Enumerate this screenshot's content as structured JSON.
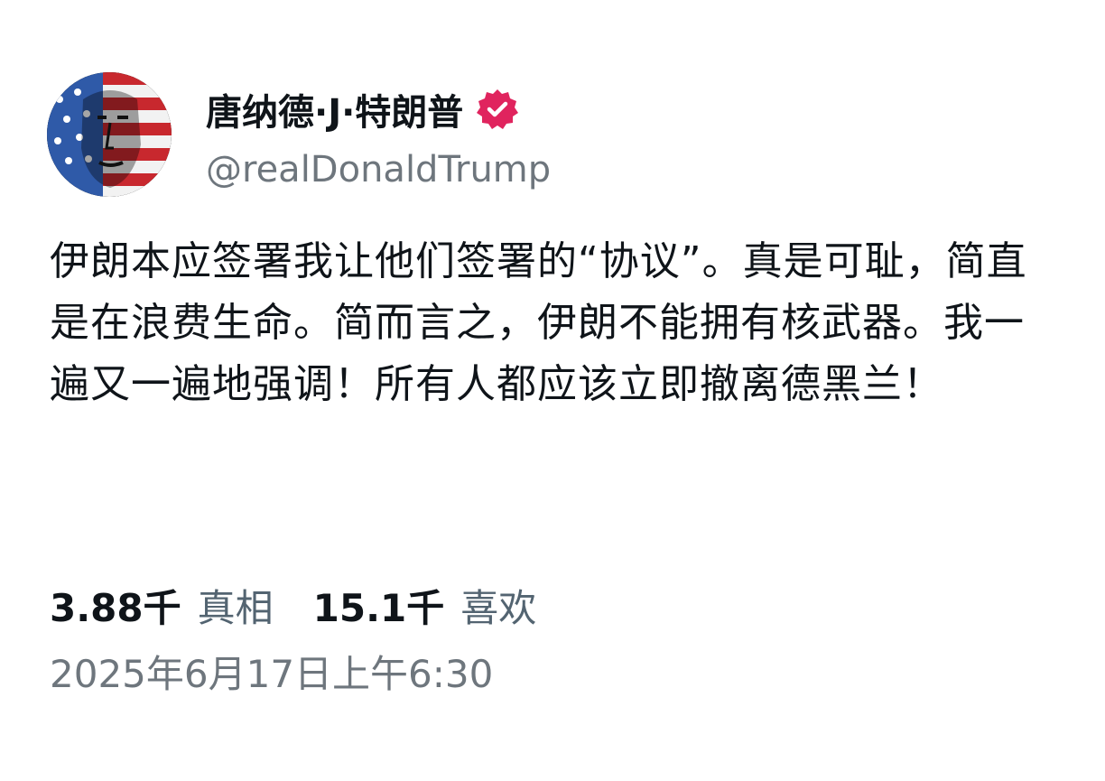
{
  "post": {
    "author": {
      "display_name": "唐纳德·J·特朗普",
      "handle": "@realDonaldTrump",
      "verified_color": "#e0245e",
      "avatar_icon": "flag-portrait-avatar"
    },
    "text": "伊朗本应签署我让他们签署的“协议”。真是可耻，简直是在浪费生命。简而言之，伊朗不能拥有核武器。我一遍又一遍地强调！所有人都应该立即撤离德黑兰！",
    "stats": {
      "truths_count": "3.88千",
      "truths_label": "真相",
      "likes_count": "15.1千",
      "likes_label": "喜欢"
    },
    "timestamp": "2025年6月17日上午6:30"
  }
}
